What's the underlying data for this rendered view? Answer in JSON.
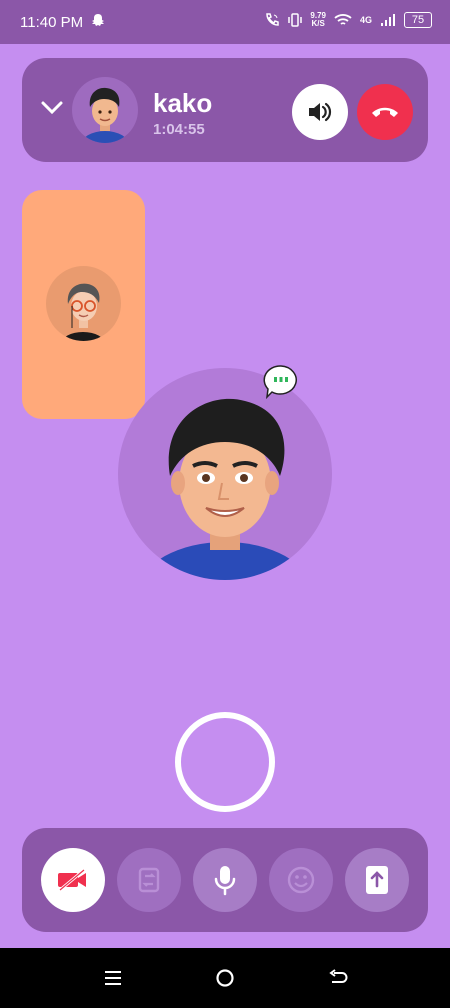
{
  "status_bar": {
    "time": "11:40 PM",
    "net_speed_value": "9.79",
    "net_speed_unit": "K/S",
    "network": "4G",
    "battery": "75"
  },
  "call": {
    "caller_name": "kako",
    "duration": "1:04:55",
    "end_color": "#F0304E"
  },
  "colors": {
    "background": "#C58EF0",
    "panel": "#8B57A8",
    "self_tile": "#FFA97A"
  },
  "icons": [
    "snapchat-ghost-icon",
    "wifi-call-icon",
    "vibrate-icon",
    "wifi-icon",
    "signal-icon",
    "battery-icon",
    "chevron-down-icon",
    "speaker-icon",
    "end-call-icon",
    "video-off-icon",
    "flip-camera-icon",
    "microphone-icon",
    "emoji-icon",
    "share-screen-icon",
    "typing-bubble-icon",
    "nav-menu-icon",
    "nav-home-icon",
    "nav-back-icon"
  ]
}
